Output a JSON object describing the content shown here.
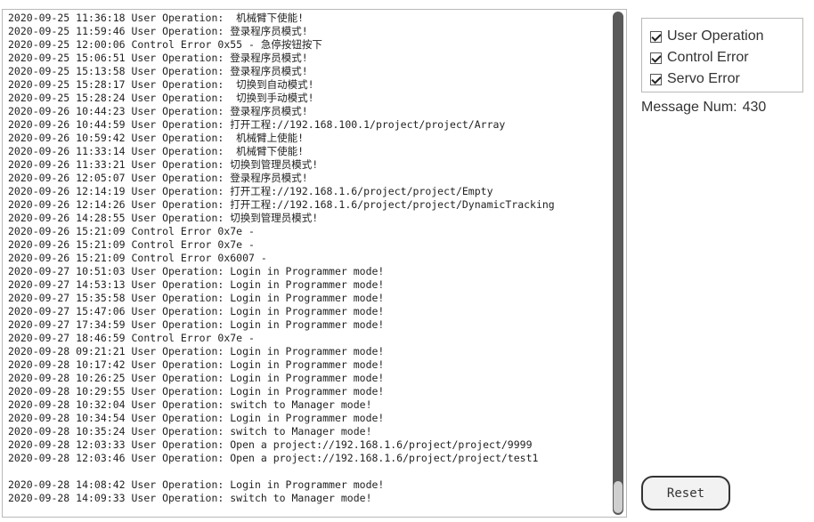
{
  "log": {
    "lines": [
      "2020-09-25 11:36:18 User Operation:  机械臂下使能!",
      "2020-09-25 11:59:46 User Operation: 登录程序员模式!",
      "2020-09-25 12:00:06 Control Error 0x55 - 急停按钮按下",
      "2020-09-25 15:06:51 User Operation: 登录程序员模式!",
      "2020-09-25 15:13:58 User Operation: 登录程序员模式!",
      "2020-09-25 15:28:17 User Operation:  切换到自动模式!",
      "2020-09-25 15:28:24 User Operation:  切换到手动模式!",
      "2020-09-26 10:44:23 User Operation: 登录程序员模式!",
      "2020-09-26 10:44:59 User Operation: 打开工程://192.168.100.1/project/project/Array",
      "2020-09-26 10:59:42 User Operation:  机械臂上使能!",
      "2020-09-26 11:33:14 User Operation:  机械臂下使能!",
      "2020-09-26 11:33:21 User Operation: 切换到管理员模式!",
      "2020-09-26 12:05:07 User Operation: 登录程序员模式!",
      "2020-09-26 12:14:19 User Operation: 打开工程://192.168.1.6/project/project/Empty",
      "2020-09-26 12:14:26 User Operation: 打开工程://192.168.1.6/project/project/DynamicTracking",
      "2020-09-26 14:28:55 User Operation: 切换到管理员模式!",
      "2020-09-26 15:21:09 Control Error 0x7e -",
      "2020-09-26 15:21:09 Control Error 0x7e -",
      "2020-09-26 15:21:09 Control Error 0x6007 -",
      "2020-09-27 10:51:03 User Operation: Login in Programmer mode!",
      "2020-09-27 14:53:13 User Operation: Login in Programmer mode!",
      "2020-09-27 15:35:58 User Operation: Login in Programmer mode!",
      "2020-09-27 15:47:06 User Operation: Login in Programmer mode!",
      "2020-09-27 17:34:59 User Operation: Login in Programmer mode!",
      "2020-09-27 18:46:59 Control Error 0x7e -",
      "2020-09-28 09:21:21 User Operation: Login in Programmer mode!",
      "2020-09-28 10:17:42 User Operation: Login in Programmer mode!",
      "2020-09-28 10:26:25 User Operation: Login in Programmer mode!",
      "2020-09-28 10:29:55 User Operation: Login in Programmer mode!",
      "2020-09-28 10:32:04 User Operation: switch to Manager mode!",
      "2020-09-28 10:34:54 User Operation: Login in Programmer mode!",
      "2020-09-28 10:35:24 User Operation: switch to Manager mode!",
      "2020-09-28 12:03:33 User Operation: Open a project://192.168.1.6/project/project/9999",
      "2020-09-28 12:03:46 User Operation: Open a project://192.168.1.6/project/project/test1",
      "",
      "2020-09-28 14:08:42 User Operation: Login in Programmer mode!",
      "2020-09-28 14:09:33 User Operation: switch to Manager mode!"
    ]
  },
  "filters": [
    {
      "label": "User Operation",
      "checked": true
    },
    {
      "label": "Control Error",
      "checked": true
    },
    {
      "label": "Servo Error",
      "checked": true
    }
  ],
  "message_count": {
    "label": "Message Num:",
    "value": "430"
  },
  "reset": {
    "label": "Reset"
  }
}
